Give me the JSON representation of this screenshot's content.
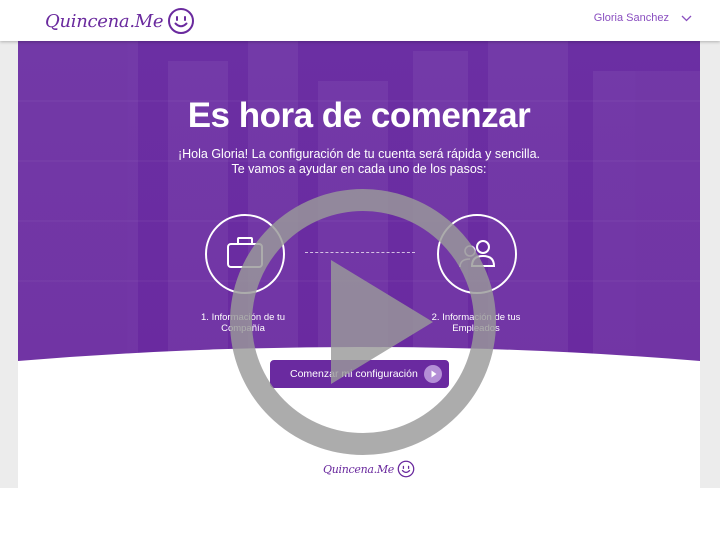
{
  "header": {
    "brand": "Quincena.Me",
    "user_name": "Gloria Sanchez",
    "brand_color": "#6a2a9e"
  },
  "hero": {
    "title": "Es hora de comenzar",
    "subtitle_line1": "¡Hola Gloria! La configuración de tu cuenta será rápida y sencilla.",
    "subtitle_line2": "Te vamos a ayudar en cada uno de los pasos:",
    "background_color": "#6a2aa0",
    "steps": [
      {
        "icon": "briefcase-icon",
        "line1": "1. Información de tu",
        "line2": "Compañía"
      },
      {
        "icon": "users-icon",
        "line1": "2. Información de tus",
        "line2": "Empleados"
      }
    ],
    "cta_label": "Comenzar mi configuración"
  },
  "footer": {
    "brand": "Quincena.Me"
  },
  "video_overlay": {
    "icon": "play-icon"
  }
}
